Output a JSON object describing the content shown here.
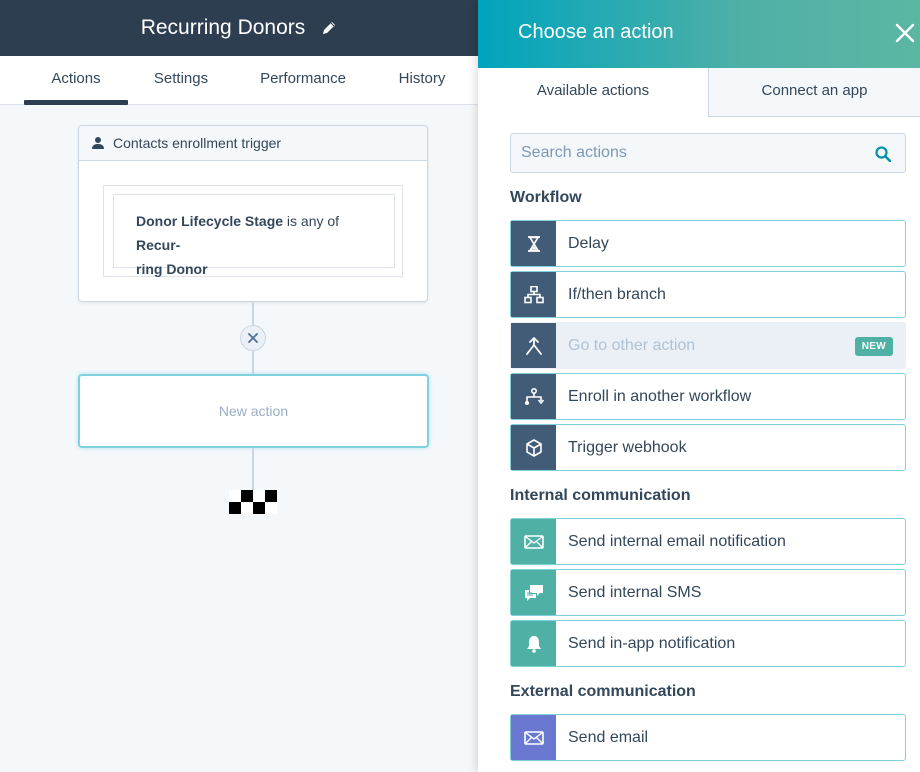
{
  "workflow": {
    "title": "Recurring Donors",
    "tabs": [
      {
        "label": "Actions"
      },
      {
        "label": "Settings"
      },
      {
        "label": "Performance"
      },
      {
        "label": "History"
      }
    ],
    "trigger": {
      "header": "Contacts enrollment trigger",
      "property": "Donor Lifecycle Stage",
      "operator": " is any of ",
      "value_line1": "Recur-",
      "value_line2": "ring Donor"
    },
    "new_action_label": "New action"
  },
  "panel": {
    "title": "Choose an action",
    "tabs": {
      "available": "Available actions",
      "connect": "Connect an app"
    },
    "search_placeholder": "Search actions",
    "sections": {
      "workflow": "Workflow",
      "internal": "Internal communication",
      "external": "External communication"
    },
    "workflow_actions": [
      {
        "label": "Delay",
        "icon": "hourglass-icon"
      },
      {
        "label": "If/then branch",
        "icon": "branch-icon"
      },
      {
        "label": "Go to other action",
        "icon": "merge-arrow-icon",
        "badge": "NEW",
        "disabled": true
      },
      {
        "label": "Enroll in another workflow",
        "icon": "enroll-workflow-icon"
      },
      {
        "label": "Trigger webhook",
        "icon": "cube-icon"
      }
    ],
    "internal_actions": [
      {
        "label": "Send internal email notification",
        "icon": "envelope-icon"
      },
      {
        "label": "Send internal SMS",
        "icon": "chat-bubbles-icon"
      },
      {
        "label": "Send in-app notification",
        "icon": "bell-icon"
      }
    ],
    "external_actions": [
      {
        "label": "Send email",
        "icon": "envelope-icon"
      }
    ],
    "colors": {
      "header_gradient_start": "#00a4bd",
      "header_gradient_end": "#5bb7a3",
      "workflow_icon_bg": "#425b76",
      "internal_icon_bg": "#4fb0a6",
      "external_icon_bg": "#6a78d1",
      "badge_bg": "#4fb0a6"
    }
  }
}
